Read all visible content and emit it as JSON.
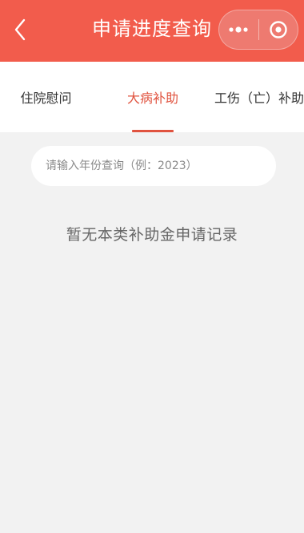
{
  "header": {
    "title": "申请进度查询",
    "back_icon": "chevron-left-icon",
    "more_icon": "more-dots-icon",
    "close_icon": "target-icon",
    "background": "#f25c4c"
  },
  "tabs": [
    {
      "label": "住院慰问",
      "active": false
    },
    {
      "label": "大病补助",
      "active": true
    },
    {
      "label": "工伤（亡）补助",
      "active": false
    }
  ],
  "search": {
    "placeholder": "请输入年份查询（例：2023）",
    "value": ""
  },
  "empty_state": {
    "message": "暂无本类补助金申请记录"
  },
  "colors": {
    "accent": "#e0533f",
    "page_background": "#f2f2f2"
  }
}
